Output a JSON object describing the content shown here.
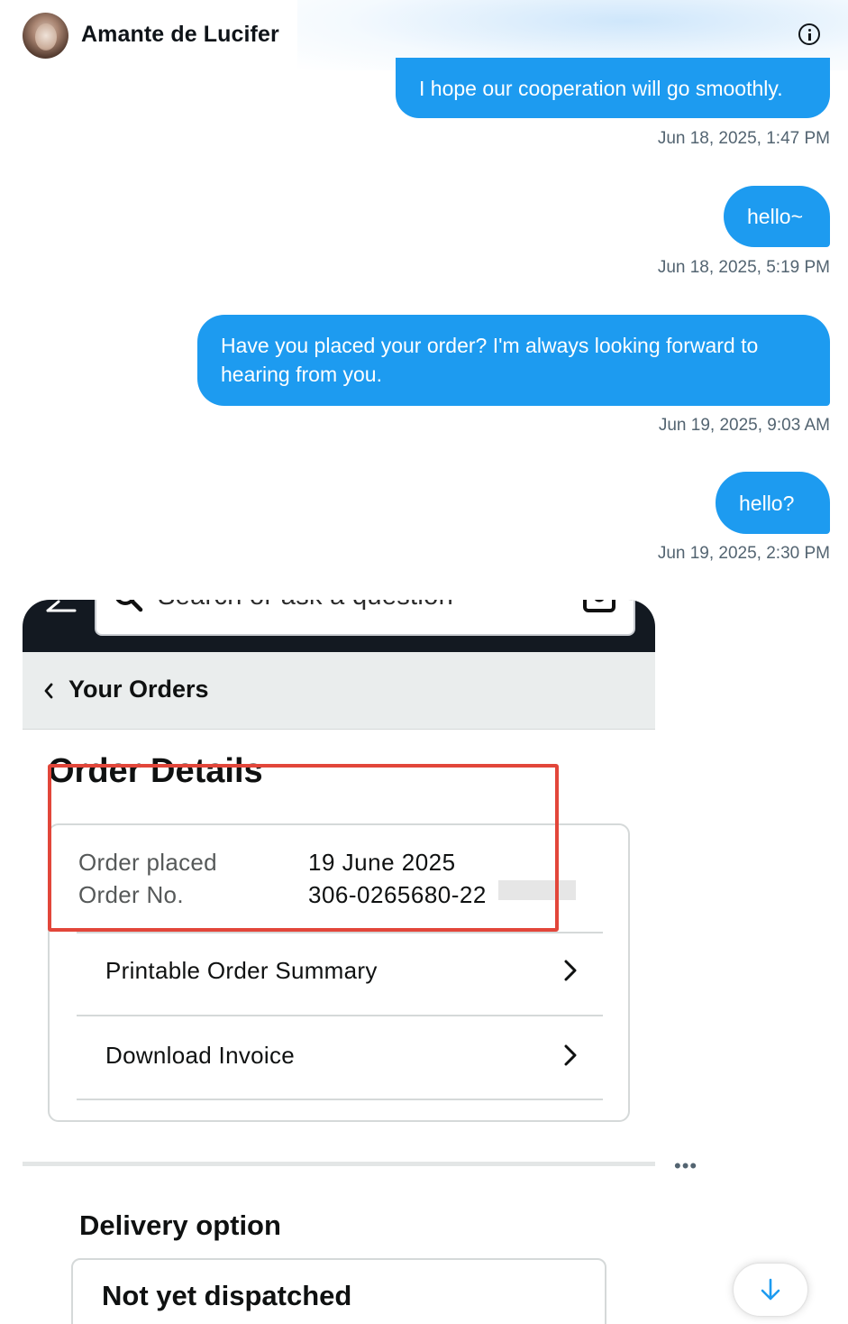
{
  "header": {
    "contact_name": "Amante de Lucifer",
    "avatar_icon": "avatar",
    "info_icon": "info-icon"
  },
  "messages": [
    {
      "text": "I hope our cooperation will go smoothly.",
      "timestamp": "Jun 18, 2025, 1:47 PM"
    },
    {
      "text": "hello~",
      "timestamp": "Jun 18, 2025, 5:19 PM"
    },
    {
      "text": "Have you placed your order? I'm always looking forward to hearing from you.",
      "timestamp": "Jun 19, 2025, 9:03 AM"
    },
    {
      "text": "hello?",
      "timestamp": "Jun 19, 2025, 2:30 PM"
    }
  ],
  "attachment": {
    "search_placeholder": "Search or ask a question",
    "back_label": "Your Orders",
    "page_title": "Order Details",
    "order_placed_label": "Order placed",
    "order_placed_value": "19 June 2025",
    "order_no_label": "Order No.",
    "order_no_value": "306-0265680-22",
    "rows": [
      {
        "label": "Printable Order Summary"
      },
      {
        "label": "Download Invoice"
      }
    ],
    "delivery_title": "Delivery option",
    "delivery_status": "Not yet dispatched"
  },
  "controls": {
    "more_label": "•••",
    "scroll_icon": "arrow-down-icon"
  },
  "colors": {
    "bubble": "#1d9bf0",
    "timestamp": "#536471",
    "highlight": "#e2463a",
    "amazon_topbar": "#131921"
  }
}
